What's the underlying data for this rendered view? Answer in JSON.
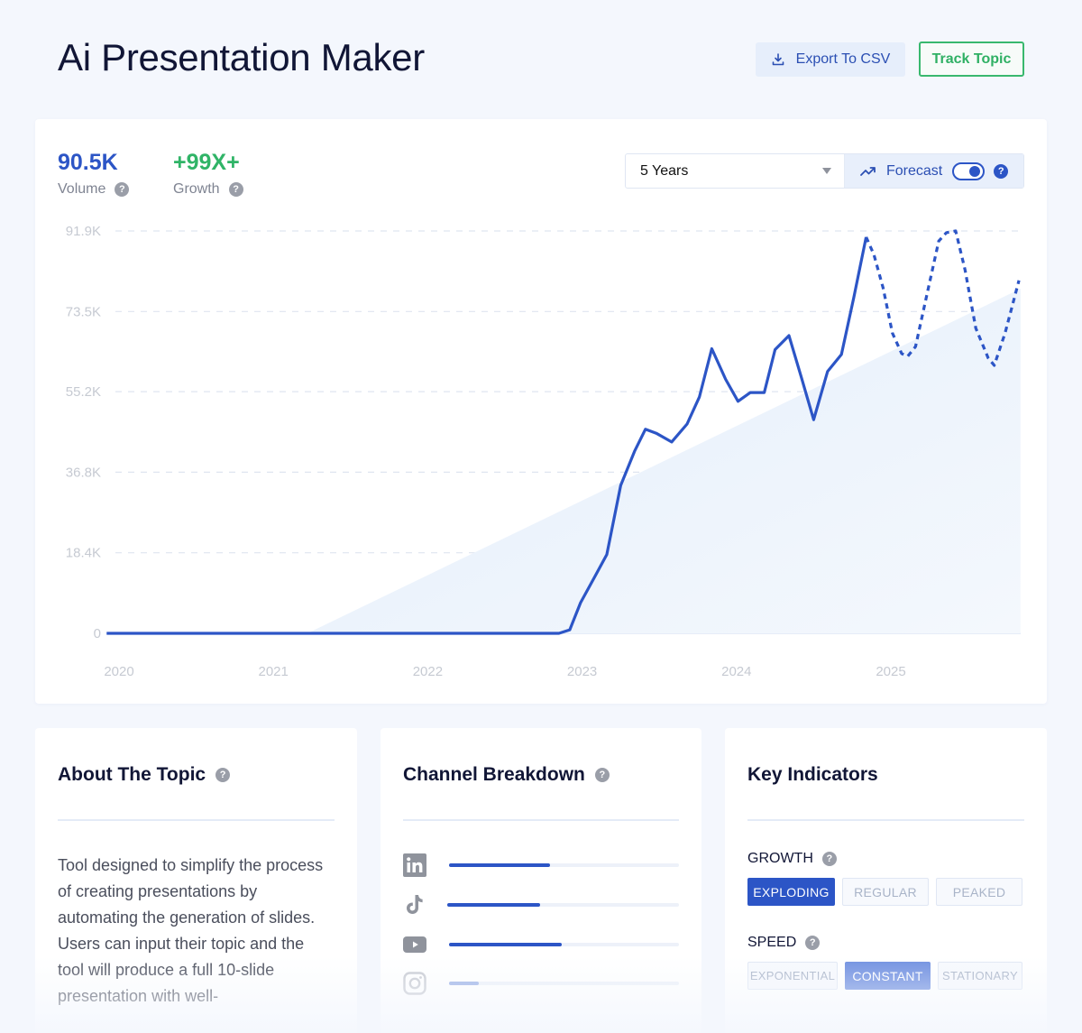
{
  "header": {
    "title": "Ai Presentation Maker",
    "export_label": "Export To CSV",
    "track_label": "Track Topic"
  },
  "metrics": {
    "volume_value": "90.5K",
    "volume_label": "Volume",
    "growth_value": "+99X+",
    "growth_label": "Growth"
  },
  "controls": {
    "range_selected": "5 Years",
    "forecast_label": "Forecast",
    "forecast_enabled": true
  },
  "colors": {
    "accent": "#2c55c6",
    "growth": "#30b467",
    "trend_fill": "#e3eefb"
  },
  "chart_data": {
    "type": "line",
    "title": "",
    "xlabel": "",
    "ylabel": "",
    "x_ticks": [
      "2020",
      "2021",
      "2022",
      "2023",
      "2024",
      "2025"
    ],
    "y_ticks": [
      "0",
      "18.4K",
      "36.8K",
      "55.2K",
      "73.5K",
      "91.9K"
    ],
    "y_tick_values": [
      0,
      18400,
      36800,
      55200,
      73500,
      91900
    ],
    "xlim": [
      2019.92,
      2025.84
    ],
    "ylim": [
      0,
      91900
    ],
    "grid": true,
    "series": [
      {
        "name": "Volume",
        "style": "solid",
        "points": [
          [
            2019.92,
            0
          ],
          [
            2022.85,
            0
          ],
          [
            2022.92,
            800
          ],
          [
            2022.99,
            7000
          ],
          [
            2023.08,
            12800
          ],
          [
            2023.16,
            18000
          ],
          [
            2023.25,
            33800
          ],
          [
            2023.34,
            41600
          ],
          [
            2023.41,
            46600
          ],
          [
            2023.48,
            45700
          ],
          [
            2023.58,
            43700
          ],
          [
            2023.68,
            47800
          ],
          [
            2023.76,
            54000
          ],
          [
            2023.84,
            65000
          ],
          [
            2023.93,
            58000
          ],
          [
            2024.01,
            53000
          ],
          [
            2024.09,
            55000
          ],
          [
            2024.18,
            55000
          ],
          [
            2024.25,
            64800
          ],
          [
            2024.34,
            68000
          ],
          [
            2024.42,
            58500
          ],
          [
            2024.5,
            48800
          ],
          [
            2024.59,
            59800
          ],
          [
            2024.68,
            63700
          ],
          [
            2024.76,
            76700
          ],
          [
            2024.84,
            90500
          ]
        ]
      },
      {
        "name": "Forecast",
        "style": "dashed",
        "points": [
          [
            2024.84,
            90500
          ],
          [
            2024.89,
            86500
          ],
          [
            2024.95,
            78900
          ],
          [
            2025.01,
            68600
          ],
          [
            2025.07,
            63900
          ],
          [
            2025.11,
            63300
          ],
          [
            2025.16,
            65500
          ],
          [
            2025.22,
            75200
          ],
          [
            2025.31,
            89600
          ],
          [
            2025.36,
            91500
          ],
          [
            2025.42,
            91900
          ],
          [
            2025.48,
            83100
          ],
          [
            2025.55,
            69700
          ],
          [
            2025.63,
            62900
          ],
          [
            2025.67,
            61200
          ],
          [
            2025.74,
            68600
          ],
          [
            2025.83,
            80600
          ]
        ]
      },
      {
        "name": "Trend",
        "style": "area",
        "points": [
          [
            2021.22,
            0
          ],
          [
            2025.84,
            78700
          ]
        ]
      }
    ]
  },
  "about": {
    "title": "About The Topic",
    "text": "Tool designed to simplify the process of creating presentations by automating the generation of slides. Users can input their topic and the tool will produce a full 10-slide presentation with well-"
  },
  "channels": {
    "title": "Channel Breakdown",
    "items": [
      {
        "name": "LinkedIn",
        "icon": "linkedin-icon",
        "share": 0.44
      },
      {
        "name": "TikTok",
        "icon": "tiktok-icon",
        "share": 0.4
      },
      {
        "name": "YouTube",
        "icon": "youtube-icon",
        "share": 0.49
      },
      {
        "name": "Instagram",
        "icon": "instagram-icon",
        "share": 0.13
      }
    ]
  },
  "key_indicators": {
    "title": "Key Indicators",
    "growth_label": "GROWTH",
    "growth_options": [
      "EXPLODING",
      "REGULAR",
      "PEAKED"
    ],
    "growth_selected": "EXPLODING",
    "speed_label": "SPEED",
    "speed_options": [
      "EXPONENTIAL",
      "CONSTANT",
      "STATIONARY"
    ],
    "speed_selected": "CONSTANT"
  }
}
